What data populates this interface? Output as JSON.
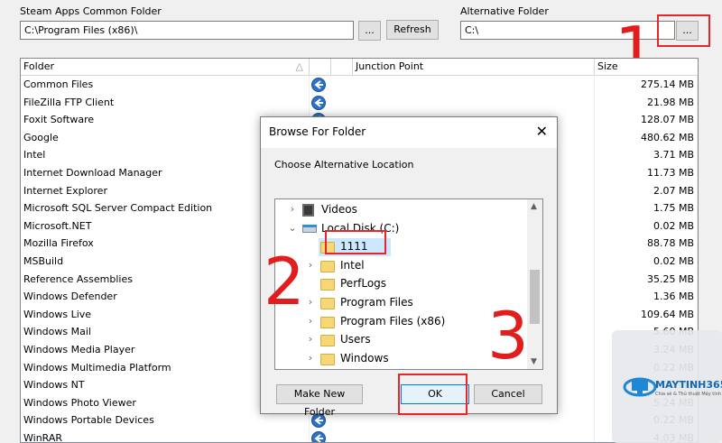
{
  "top": {
    "steam_label": "Steam Apps Common Folder",
    "steam_path": "C:\\Program Files (x86)\\",
    "browse_btn": "...",
    "refresh_btn": "Refresh",
    "alt_label": "Alternative Folder",
    "alt_path": "C:\\",
    "alt_browse_btn": "..."
  },
  "table": {
    "headers": {
      "folder": "Folder",
      "junction": "Junction Point",
      "size": "Size"
    },
    "rows": [
      {
        "folder": "Common Files",
        "size": "275.14 MB"
      },
      {
        "folder": "FileZilla FTP Client",
        "size": "21.98 MB"
      },
      {
        "folder": "Foxit Software",
        "size": "128.07 MB"
      },
      {
        "folder": "Google",
        "size": "480.62 MB"
      },
      {
        "folder": "Intel",
        "size": "3.71 MB"
      },
      {
        "folder": "Internet Download Manager",
        "size": "11.73 MB"
      },
      {
        "folder": "Internet Explorer",
        "size": "2.07 MB"
      },
      {
        "folder": "Microsoft SQL Server Compact Edition",
        "size": "1.75 MB"
      },
      {
        "folder": "Microsoft.NET",
        "size": "0.02 MB"
      },
      {
        "folder": "Mozilla Firefox",
        "size": "88.78 MB"
      },
      {
        "folder": "MSBuild",
        "size": "0.02 MB"
      },
      {
        "folder": "Reference Assemblies",
        "size": "35.25 MB"
      },
      {
        "folder": "Windows Defender",
        "size": "1.36 MB"
      },
      {
        "folder": "Windows Live",
        "size": "109.64 MB"
      },
      {
        "folder": "Windows Mail",
        "size": "5.60 MB"
      },
      {
        "folder": "Windows Media Player",
        "size": "3.24 MB"
      },
      {
        "folder": "Windows Multimedia Platform",
        "size": "0.22 MB"
      },
      {
        "folder": "Windows NT",
        "size": "0.00 MB"
      },
      {
        "folder": "Windows Photo Viewer",
        "size": "5.24 MB"
      },
      {
        "folder": "Windows Portable Devices",
        "size": "0.22 MB"
      },
      {
        "folder": "WinRAR",
        "size": "4.03 MB"
      }
    ]
  },
  "dialog": {
    "title": "Browse For Folder",
    "close": "✕",
    "prompt": "Choose Alternative Location",
    "tree": [
      {
        "label": "Videos",
        "chev": "›"
      },
      {
        "label": "Local Disk (C:)",
        "chev": "⌄"
      },
      {
        "label": "1111",
        "chev": ""
      },
      {
        "label": "Intel",
        "chev": "›"
      },
      {
        "label": "PerfLogs",
        "chev": ""
      },
      {
        "label": "Program Files",
        "chev": "›"
      },
      {
        "label": "Program Files (x86)",
        "chev": "›"
      },
      {
        "label": "Users",
        "chev": "›"
      },
      {
        "label": "Windows",
        "chev": "›"
      }
    ],
    "make_folder_btn": "Make New Folder",
    "ok_btn": "OK",
    "cancel_btn": "Cancel"
  },
  "annotations": {
    "n1": "1",
    "n2": "2",
    "n3": "3"
  },
  "watermark": {
    "brand": "MAYTINH365",
    "tagline": "Chia sẻ & Thủ thuật Máy tính"
  },
  "colors": {
    "accent_blue": "#2c72c7",
    "annotation_red": "#e21d1d"
  }
}
